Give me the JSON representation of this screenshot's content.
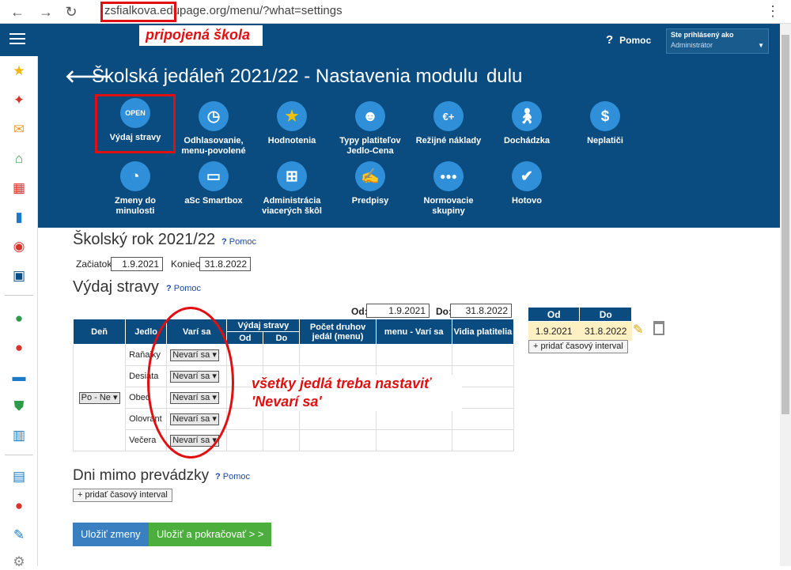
{
  "browser": {
    "url": "zsfialkova.edupage.org/menu/?what=settings"
  },
  "topbar": {
    "school_note": "pripojená škola",
    "help": "Pomoc",
    "user_label": "Ste prihlásený ako",
    "user_value": "Administrátor"
  },
  "header": {
    "title": "Školská jedáleň 2021/22 - Nastavenia modulu",
    "tiles_row1": [
      {
        "label": "Výdaj stravy",
        "icon": "open-sign-icon"
      },
      {
        "label": "Odhlasovanie, menu-povolené",
        "icon": "clock-icon"
      },
      {
        "label": "Hodnotenia",
        "icon": "star-icon"
      },
      {
        "label": "Typy platiteľov Jedlo-Cena",
        "icon": "payer-icon"
      },
      {
        "label": "Režijné náklady",
        "icon": "euro-plus-icon"
      },
      {
        "label": "Dochádzka",
        "icon": "walking-icon"
      },
      {
        "label": "Neplatiči",
        "icon": "money-bag-icon"
      }
    ],
    "tiles_row2": [
      {
        "label": "Zmeny do minulosti",
        "icon": "history-clock-icon"
      },
      {
        "label": "aSc Smartbox",
        "icon": "monitor-icon"
      },
      {
        "label": "Administrácia viacerých škôl",
        "icon": "hierarchy-icon"
      },
      {
        "label": "Predpisy",
        "icon": "handshake-icon"
      },
      {
        "label": "Normovacie skupiny",
        "icon": "groups-icon"
      },
      {
        "label": "Hotovo",
        "icon": "check-icon"
      }
    ]
  },
  "school_year": {
    "title": "Školský rok 2021/22",
    "help": "Pomoc",
    "start_label": "Začiatok:",
    "start": "1.9.2021",
    "end_label": "Koniec:",
    "end": "31.8.2022"
  },
  "dispense": {
    "title": "Výdaj stravy",
    "help": "Pomoc",
    "from_label": "Od:",
    "from": "1.9.2021",
    "to_label": "Do:",
    "to": "31.8.2022",
    "headers": {
      "day": "Deň",
      "meal": "Jedlo",
      "cooks": "Varí sa",
      "dispense": "Výdaj stravy",
      "from": "Od",
      "to": "Do",
      "count": "Počet druhov jedál (menu)",
      "menu": "menu - Varí sa",
      "payer": "Vidia platitelia"
    },
    "day_select": "Po - Ne",
    "meals": [
      {
        "name": "Raňajky",
        "value": "Nevarí sa"
      },
      {
        "name": "Desiata",
        "value": "Nevarí sa"
      },
      {
        "name": "Obed",
        "value": "Nevarí sa"
      },
      {
        "name": "Olovrant",
        "value": "Nevarí sa"
      },
      {
        "name": "Večera",
        "value": "Nevarí sa"
      }
    ],
    "annotation_l1": "všetky jedlá treba nastaviť",
    "annotation_l2": "'Nevarí sa'"
  },
  "intervals": {
    "from_header": "Od",
    "to_header": "Do",
    "from": "1.9.2021",
    "to": "31.8.2022",
    "add": "+ pridať časový interval"
  },
  "closures": {
    "title": "Dni mimo prevádzky",
    "help": "Pomoc",
    "add": "+ pridať časový interval"
  },
  "actions": {
    "save": "Uložiť zmeny",
    "save_continue": "Uložiť a pokračovať > >"
  },
  "colors": {
    "brand": "#0a4c80",
    "accent": "#2f8fd8",
    "annotation": "#e01010",
    "save": "#3a7fc0",
    "continue": "#4caf3d"
  }
}
